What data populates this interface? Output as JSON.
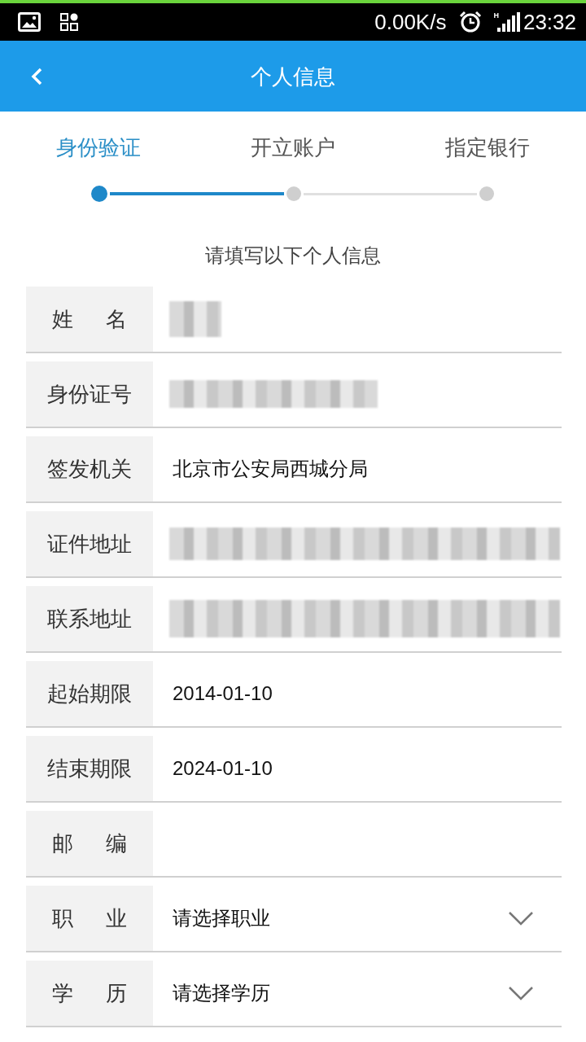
{
  "status_bar": {
    "network_speed": "0.00K/s",
    "network_type": "H",
    "time": "23:32"
  },
  "header": {
    "title": "个人信息"
  },
  "steps": [
    {
      "label": "身份验证",
      "selected": true
    },
    {
      "label": "开立账户",
      "selected": false
    },
    {
      "label": "指定银行",
      "selected": false
    }
  ],
  "instruction": "请填写以下个人信息",
  "fields": [
    {
      "kind": "blurred",
      "label": "姓 名"
    },
    {
      "kind": "blurred",
      "label": "身份证号"
    },
    {
      "kind": "text",
      "label": "签发机关",
      "value": "北京市公安局西城分局"
    },
    {
      "kind": "blurred",
      "label": "证件地址"
    },
    {
      "kind": "blurred",
      "label": "联系地址"
    },
    {
      "kind": "text",
      "label": "起始期限",
      "value": "2014-01-10"
    },
    {
      "kind": "text",
      "label": "结束期限",
      "value": "2024-01-10"
    },
    {
      "kind": "input",
      "label": "邮 编"
    },
    {
      "kind": "select",
      "label": "职 业",
      "placeholder": "请选择职业"
    },
    {
      "kind": "select",
      "label": "学 历",
      "placeholder": "请选择学历"
    }
  ]
}
